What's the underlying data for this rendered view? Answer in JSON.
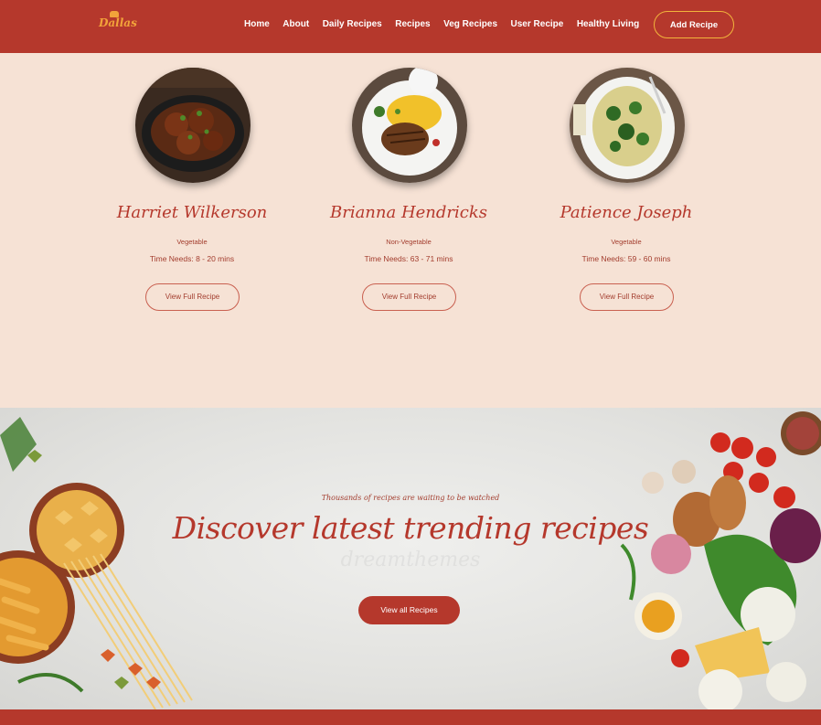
{
  "header": {
    "logo_text": "Dallas",
    "nav": [
      "Home",
      "About",
      "Daily Recipes",
      "Recipes",
      "Veg Recipes",
      "User Recipe",
      "Healthy Living"
    ],
    "add_button": "Add Recipe"
  },
  "recipes": [
    {
      "name": "Harriet Wilkerson",
      "category": "Vegetable",
      "time": "Time Needs: 8 - 20 mins",
      "button": "View Full Recipe"
    },
    {
      "name": "Brianna Hendricks",
      "category": "Non-Vegetable",
      "time": "Time Needs: 63 - 71 mins",
      "button": "View Full Recipe"
    },
    {
      "name": "Patience Joseph",
      "category": "Vegetable",
      "time": "Time Needs: 59 - 60 mins",
      "button": "View Full Recipe"
    }
  ],
  "banner": {
    "subtitle": "Thousands of recipes are waiting to be watched",
    "title": "Discover latest trending recipes",
    "ghost_text": "dreamthemes",
    "button": "View all Recipes"
  },
  "colors": {
    "brand": "#b5382c",
    "accent": "#f2a33a",
    "background": "#f6e2d5"
  }
}
